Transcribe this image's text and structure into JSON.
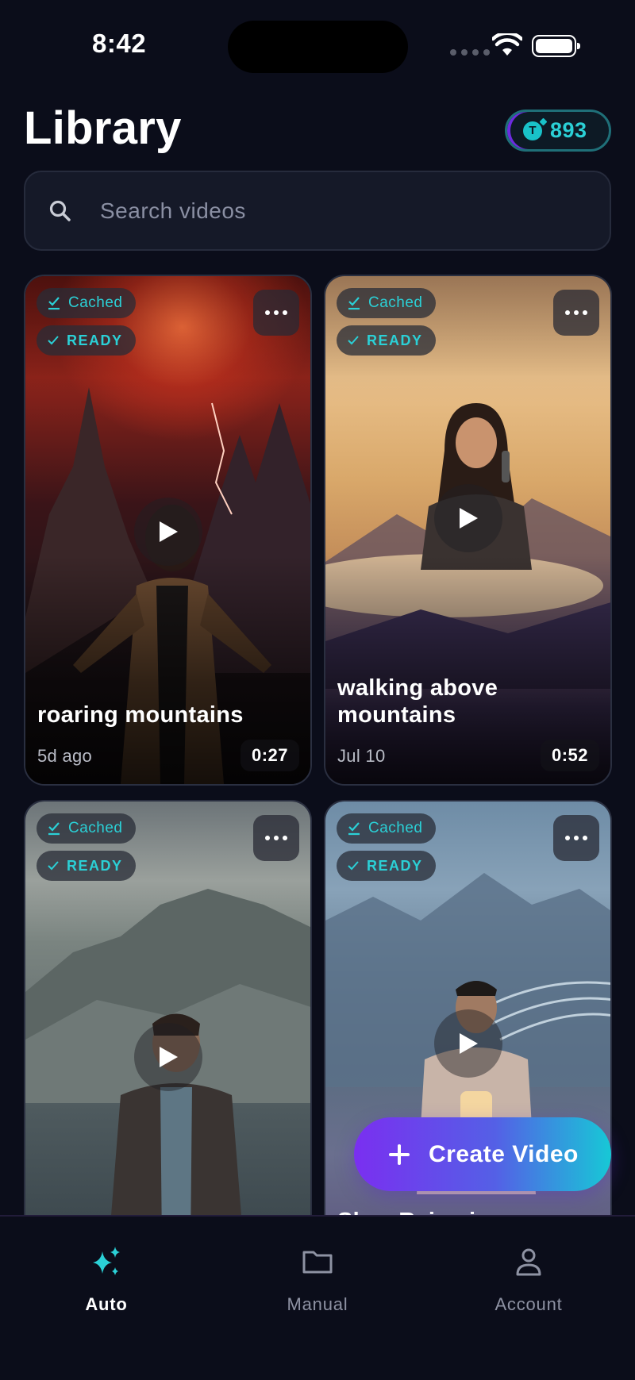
{
  "status_bar": {
    "time": "8:42"
  },
  "header": {
    "title": "Library",
    "credits": {
      "icon": "token-sparkle-icon",
      "value": "893"
    }
  },
  "search": {
    "placeholder": "Search videos",
    "value": ""
  },
  "videos": [
    {
      "title": "roaring mountains",
      "date": "5d ago",
      "duration": "0:27",
      "cached_label": "Cached",
      "status_label": "READY"
    },
    {
      "title": "walking above mountains",
      "date": "Jul 10",
      "duration": "0:52",
      "cached_label": "Cached",
      "status_label": "READY"
    },
    {
      "title": "",
      "date": "",
      "duration": "",
      "cached_label": "Cached",
      "status_label": "READY"
    },
    {
      "title": "Slow Rains in",
      "date": "",
      "duration": "",
      "cached_label": "Cached",
      "status_label": "READY"
    }
  ],
  "fab": {
    "label": "Create Video"
  },
  "bottom_nav": {
    "items": [
      {
        "label": "Auto",
        "icon": "sparkles-icon",
        "active": true
      },
      {
        "label": "Manual",
        "icon": "folder-icon",
        "active": false
      },
      {
        "label": "Account",
        "icon": "user-icon",
        "active": false
      }
    ]
  },
  "colors": {
    "background": "#0b0d1a",
    "accent_teal": "#2bd0d6",
    "accent_purple": "#7a2ff0"
  }
}
